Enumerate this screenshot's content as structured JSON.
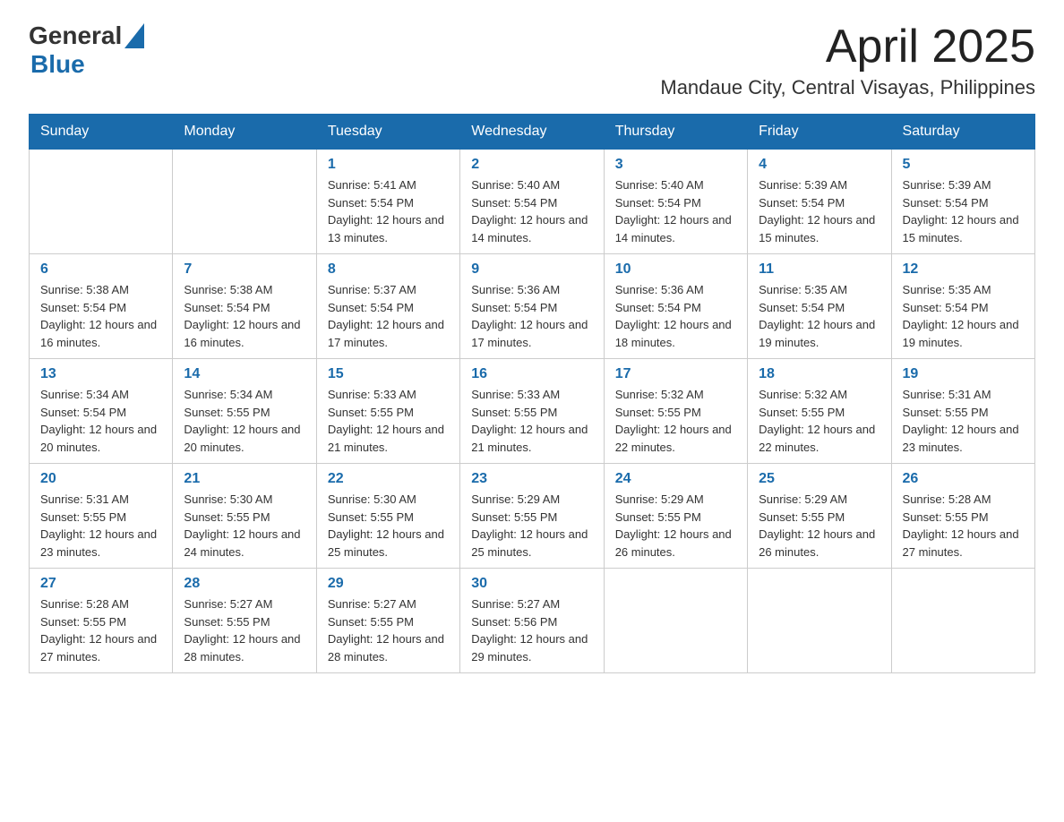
{
  "header": {
    "logo_general": "General",
    "logo_blue": "Blue",
    "title": "April 2025",
    "subtitle": "Mandaue City, Central Visayas, Philippines"
  },
  "days_of_week": [
    "Sunday",
    "Monday",
    "Tuesday",
    "Wednesday",
    "Thursday",
    "Friday",
    "Saturday"
  ],
  "weeks": [
    [
      {
        "day": "",
        "info": ""
      },
      {
        "day": "",
        "info": ""
      },
      {
        "day": "1",
        "info": "Sunrise: 5:41 AM\nSunset: 5:54 PM\nDaylight: 12 hours and 13 minutes."
      },
      {
        "day": "2",
        "info": "Sunrise: 5:40 AM\nSunset: 5:54 PM\nDaylight: 12 hours and 14 minutes."
      },
      {
        "day": "3",
        "info": "Sunrise: 5:40 AM\nSunset: 5:54 PM\nDaylight: 12 hours and 14 minutes."
      },
      {
        "day": "4",
        "info": "Sunrise: 5:39 AM\nSunset: 5:54 PM\nDaylight: 12 hours and 15 minutes."
      },
      {
        "day": "5",
        "info": "Sunrise: 5:39 AM\nSunset: 5:54 PM\nDaylight: 12 hours and 15 minutes."
      }
    ],
    [
      {
        "day": "6",
        "info": "Sunrise: 5:38 AM\nSunset: 5:54 PM\nDaylight: 12 hours and 16 minutes."
      },
      {
        "day": "7",
        "info": "Sunrise: 5:38 AM\nSunset: 5:54 PM\nDaylight: 12 hours and 16 minutes."
      },
      {
        "day": "8",
        "info": "Sunrise: 5:37 AM\nSunset: 5:54 PM\nDaylight: 12 hours and 17 minutes."
      },
      {
        "day": "9",
        "info": "Sunrise: 5:36 AM\nSunset: 5:54 PM\nDaylight: 12 hours and 17 minutes."
      },
      {
        "day": "10",
        "info": "Sunrise: 5:36 AM\nSunset: 5:54 PM\nDaylight: 12 hours and 18 minutes."
      },
      {
        "day": "11",
        "info": "Sunrise: 5:35 AM\nSunset: 5:54 PM\nDaylight: 12 hours and 19 minutes."
      },
      {
        "day": "12",
        "info": "Sunrise: 5:35 AM\nSunset: 5:54 PM\nDaylight: 12 hours and 19 minutes."
      }
    ],
    [
      {
        "day": "13",
        "info": "Sunrise: 5:34 AM\nSunset: 5:54 PM\nDaylight: 12 hours and 20 minutes."
      },
      {
        "day": "14",
        "info": "Sunrise: 5:34 AM\nSunset: 5:55 PM\nDaylight: 12 hours and 20 minutes."
      },
      {
        "day": "15",
        "info": "Sunrise: 5:33 AM\nSunset: 5:55 PM\nDaylight: 12 hours and 21 minutes."
      },
      {
        "day": "16",
        "info": "Sunrise: 5:33 AM\nSunset: 5:55 PM\nDaylight: 12 hours and 21 minutes."
      },
      {
        "day": "17",
        "info": "Sunrise: 5:32 AM\nSunset: 5:55 PM\nDaylight: 12 hours and 22 minutes."
      },
      {
        "day": "18",
        "info": "Sunrise: 5:32 AM\nSunset: 5:55 PM\nDaylight: 12 hours and 22 minutes."
      },
      {
        "day": "19",
        "info": "Sunrise: 5:31 AM\nSunset: 5:55 PM\nDaylight: 12 hours and 23 minutes."
      }
    ],
    [
      {
        "day": "20",
        "info": "Sunrise: 5:31 AM\nSunset: 5:55 PM\nDaylight: 12 hours and 23 minutes."
      },
      {
        "day": "21",
        "info": "Sunrise: 5:30 AM\nSunset: 5:55 PM\nDaylight: 12 hours and 24 minutes."
      },
      {
        "day": "22",
        "info": "Sunrise: 5:30 AM\nSunset: 5:55 PM\nDaylight: 12 hours and 25 minutes."
      },
      {
        "day": "23",
        "info": "Sunrise: 5:29 AM\nSunset: 5:55 PM\nDaylight: 12 hours and 25 minutes."
      },
      {
        "day": "24",
        "info": "Sunrise: 5:29 AM\nSunset: 5:55 PM\nDaylight: 12 hours and 26 minutes."
      },
      {
        "day": "25",
        "info": "Sunrise: 5:29 AM\nSunset: 5:55 PM\nDaylight: 12 hours and 26 minutes."
      },
      {
        "day": "26",
        "info": "Sunrise: 5:28 AM\nSunset: 5:55 PM\nDaylight: 12 hours and 27 minutes."
      }
    ],
    [
      {
        "day": "27",
        "info": "Sunrise: 5:28 AM\nSunset: 5:55 PM\nDaylight: 12 hours and 27 minutes."
      },
      {
        "day": "28",
        "info": "Sunrise: 5:27 AM\nSunset: 5:55 PM\nDaylight: 12 hours and 28 minutes."
      },
      {
        "day": "29",
        "info": "Sunrise: 5:27 AM\nSunset: 5:55 PM\nDaylight: 12 hours and 28 minutes."
      },
      {
        "day": "30",
        "info": "Sunrise: 5:27 AM\nSunset: 5:56 PM\nDaylight: 12 hours and 29 minutes."
      },
      {
        "day": "",
        "info": ""
      },
      {
        "day": "",
        "info": ""
      },
      {
        "day": "",
        "info": ""
      }
    ]
  ]
}
